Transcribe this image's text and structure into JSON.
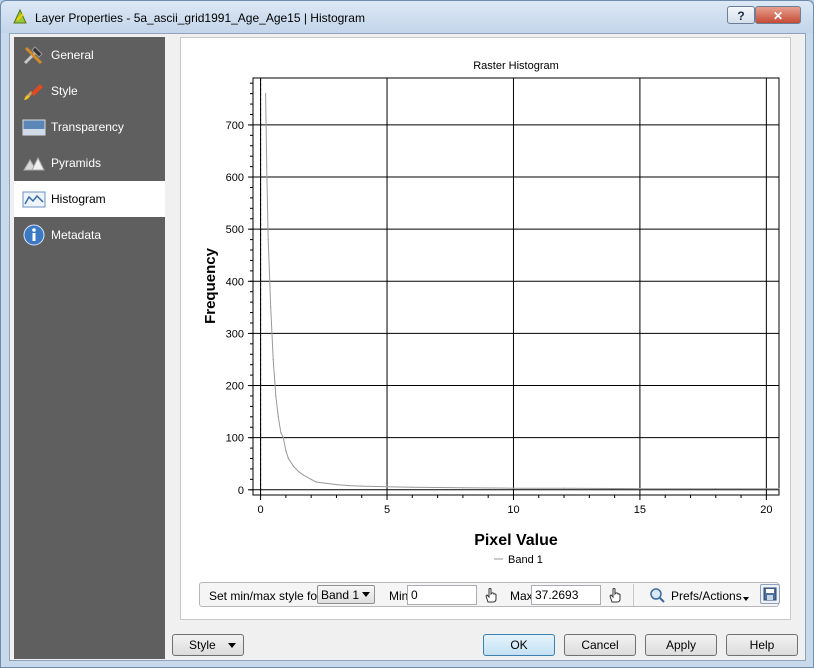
{
  "window": {
    "title": "Layer Properties - 5a_ascii_grid1991_Age_Age15 | Histogram",
    "help_symbol": "?",
    "close_symbol": "✕"
  },
  "sidebar": {
    "items": [
      {
        "label": "General",
        "icon": "wrench-hammer-icon",
        "active": false
      },
      {
        "label": "Style",
        "icon": "paintbrush-icon",
        "active": false
      },
      {
        "label": "Transparency",
        "icon": "transparency-icon",
        "active": false
      },
      {
        "label": "Pyramids",
        "icon": "pyramids-icon",
        "active": false
      },
      {
        "label": "Histogram",
        "icon": "histogram-icon",
        "active": true
      },
      {
        "label": "Metadata",
        "icon": "info-icon",
        "active": false
      }
    ]
  },
  "chart_data": {
    "type": "line",
    "title": "Raster Histogram",
    "xlabel": "Pixel Value",
    "ylabel": "Frequency",
    "xlim": [
      -0.3,
      20.5
    ],
    "ylim": [
      -10,
      790
    ],
    "xticks": [
      0,
      5,
      10,
      15,
      20
    ],
    "yticks": [
      0,
      100,
      200,
      300,
      400,
      500,
      600,
      700
    ],
    "grid": true,
    "legend_position": "bottom-center",
    "series": [
      {
        "name": "Band 1",
        "color": "#999999",
        "x": [
          0.2,
          0.25,
          0.3,
          0.4,
          0.5,
          0.6,
          0.7,
          0.8,
          0.9,
          1.0,
          1.1,
          1.3,
          1.5,
          1.7,
          2.0,
          2.2,
          2.5,
          3.0,
          3.5,
          4.0,
          5.0,
          6.0,
          8.0,
          10.0,
          12.0,
          15.0,
          18.0,
          20.5
        ],
        "y": [
          760,
          600,
          480,
          350,
          250,
          180,
          140,
          110,
          100,
          75,
          60,
          45,
          35,
          28,
          20,
          15,
          13,
          10,
          8,
          7,
          6,
          5,
          4,
          3,
          3,
          2,
          2,
          2
        ]
      }
    ]
  },
  "controls": {
    "set_minmax_label": "Set min/max style for",
    "band_selected": "Band 1",
    "min_label": "Min",
    "min_value": "0",
    "max_label": "Max",
    "max_value": "37.2693",
    "prefs_label": "Prefs/Actions"
  },
  "buttons": {
    "style": "Style",
    "ok": "OK",
    "cancel": "Cancel",
    "apply": "Apply",
    "help": "Help"
  }
}
